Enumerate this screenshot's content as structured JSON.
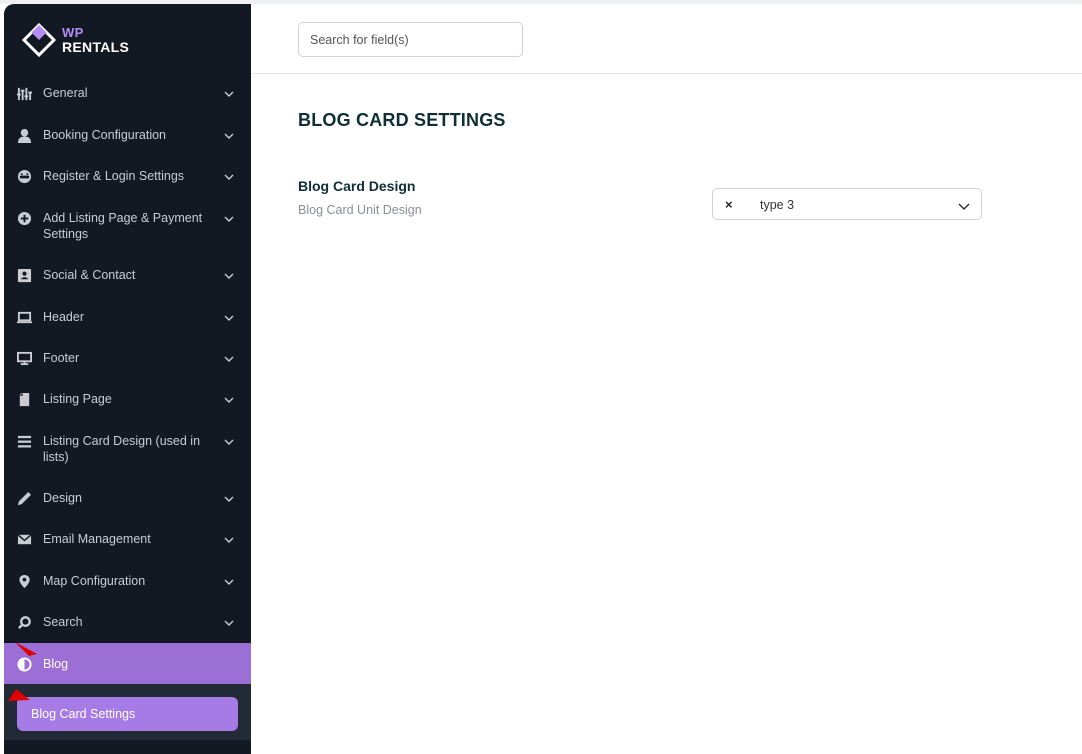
{
  "logo": {
    "line1": "WP",
    "line2": "RENTALS"
  },
  "search": {
    "placeholder": "Search for field(s)"
  },
  "sidebar": {
    "items": [
      {
        "label": "General",
        "icon": "sliders-icon"
      },
      {
        "label": "Booking Configuration",
        "icon": "user-icon"
      },
      {
        "label": "Register & Login Settings",
        "icon": "login-icon"
      },
      {
        "label": "Add Listing Page & Payment Settings",
        "icon": "plus-circle-icon"
      },
      {
        "label": "Social & Contact",
        "icon": "contact-card-icon"
      },
      {
        "label": "Header",
        "icon": "laptop-icon"
      },
      {
        "label": "Footer",
        "icon": "monitor-icon"
      },
      {
        "label": "Listing Page",
        "icon": "document-icon"
      },
      {
        "label": "Listing Card Design (used in lists)",
        "icon": "list-icon"
      },
      {
        "label": "Design",
        "icon": "pen-icon"
      },
      {
        "label": "Email Management",
        "icon": "envelope-icon"
      },
      {
        "label": "Map Configuration",
        "icon": "map-pin-icon"
      },
      {
        "label": "Search",
        "icon": "search-icon"
      },
      {
        "label": "Blog",
        "icon": "half-circle-icon"
      }
    ],
    "active_item": "Blog",
    "sub_item": "Blog Card Settings"
  },
  "main": {
    "title": "BLOG CARD SETTINGS",
    "field": {
      "title": "Blog Card Design",
      "description": "Blog Card Unit Design",
      "value": "type 3",
      "clear_symbol": "×"
    }
  },
  "colors": {
    "sidebar_bg": "#131923",
    "active_bg": "#9b6fd6",
    "sub_item_bg": "#a77be6",
    "title_color": "#0f2e36",
    "annotation_arrow": "#e00000"
  }
}
